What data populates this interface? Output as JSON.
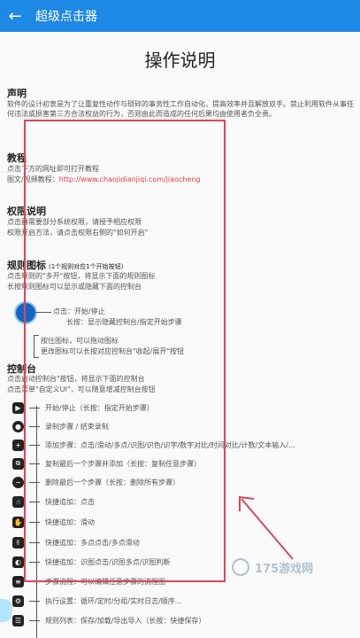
{
  "appbar": {
    "title": "超级点击器",
    "back_icon": "arrow-left-icon"
  },
  "page_heading": "操作说明",
  "declaration": {
    "title": "声明",
    "text": "软件的设计初衷是为了让重复性动作与琐碎的事务性工作自动化，提高效率并且解放双手。禁止利用软件从事任何违法或损害第三方合法权益的行为，否则由此而造成的任何后果均由使用者负全责。"
  },
  "tutorial": {
    "title": "教程",
    "line1": "点击下方的网址即可打开教程",
    "line2_label": "图文/视频教程：",
    "url": "http://www.chaojidianjiqi.com/jiaocheng"
  },
  "permission": {
    "title": "权限说明",
    "line1": "点击器需要部分系统权限，请授予相应权限",
    "line2": "权限开启方法，请点击权限右侧的\"如何开启\""
  },
  "rules_icon": {
    "title": "规则图标",
    "subtitle": "(1个规则对应1个开始按钮)",
    "line1": "点击规则的\"多开\"按钮，将显示下面的规则图标",
    "line2": "长按规则图标可以显示或隐藏下面的控制台",
    "fab_click": "点击：开始/停止",
    "fab_long": "长按：显示隐藏控制台/指定开始步骤",
    "drag": "按住图标，可以拖动图标",
    "collapse": "更改图标可以长按对应控制台\"收起/展开\"按钮"
  },
  "console": {
    "title": "控制台",
    "line1": "点击启动控制台\"按钮，将显示下面的控制台",
    "line2": "点击菜单\"自定义UI\"，可以随意增减控制台按钮",
    "items": [
      {
        "icon": "play-stop-icon",
        "symbol": "▶",
        "text": "开始/停止（长按：指定开始步骤）"
      },
      {
        "icon": "record-icon",
        "symbol": "●",
        "text": "录制步骤 / 结束录制"
      },
      {
        "icon": "add-step-icon",
        "symbol": "+",
        "text": "添加步骤：点击/滑动/多点/识图/识色/识字/数字对比/时间对比/计数/文本输入/..."
      },
      {
        "icon": "copy-step-icon",
        "symbol": "⧉",
        "text": "复制最后一个步骤并添加（长按：复制任意步骤）"
      },
      {
        "icon": "delete-step-icon",
        "symbol": "−",
        "text": "删除最后一个步骤（长按：删除所有步骤）"
      },
      {
        "icon": "quick-click-icon",
        "symbol": "☝",
        "text": "快捷追加：点击"
      },
      {
        "icon": "quick-swipe-icon",
        "symbol": "✋",
        "text": "快捷追加：滑动"
      },
      {
        "icon": "multi-touch-icon",
        "symbol": "✌",
        "text": "快捷追加：多点点击/多点滑动"
      },
      {
        "icon": "image-recognize-icon",
        "symbol": "◐",
        "text": "快捷追加：识图点击/识图多点/识图判断"
      },
      {
        "icon": "flow-icon",
        "symbol": "≡",
        "text": "步骤流程：可以编辑任意步骤的流程图"
      },
      {
        "icon": "settings-gear-icon",
        "symbol": "⚙",
        "text": "执行设置：循环/定时/分组/实时日志/顺序..."
      },
      {
        "icon": "rules-list-icon",
        "symbol": "☰",
        "text": "规则列表：保存/加载/导出导入（长按：快捷保存）"
      }
    ]
  },
  "watermark": {
    "text": "175游戏网"
  },
  "colors": {
    "appbar": "#1e88e5",
    "highlight_box": "#e0445a",
    "link": "#e53935"
  }
}
